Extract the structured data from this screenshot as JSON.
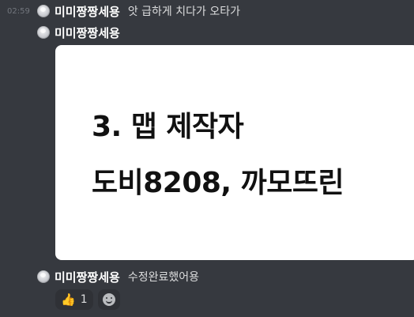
{
  "messages": [
    {
      "timestamp": "02:59",
      "username": "미미짱짱세용",
      "text": "앗 급하게 치다가 오타가"
    },
    {
      "username": "미미짱짱세용",
      "image_lines": [
        "3. 맵 제작자",
        "도비8208, 까모뜨린"
      ]
    },
    {
      "username": "미미짱짱세용",
      "text": "수정완료했어용",
      "reactions": [
        {
          "emoji": "👍",
          "count": "1"
        }
      ]
    }
  ],
  "icons": {
    "avatar": "silver-orb-avatar",
    "add_reaction": "smile-icon"
  },
  "colors": {
    "background": "#36393f",
    "username": "#ffffff",
    "text": "#dcddde",
    "timestamp": "#72767d",
    "reaction_bg": "#2f3136"
  }
}
